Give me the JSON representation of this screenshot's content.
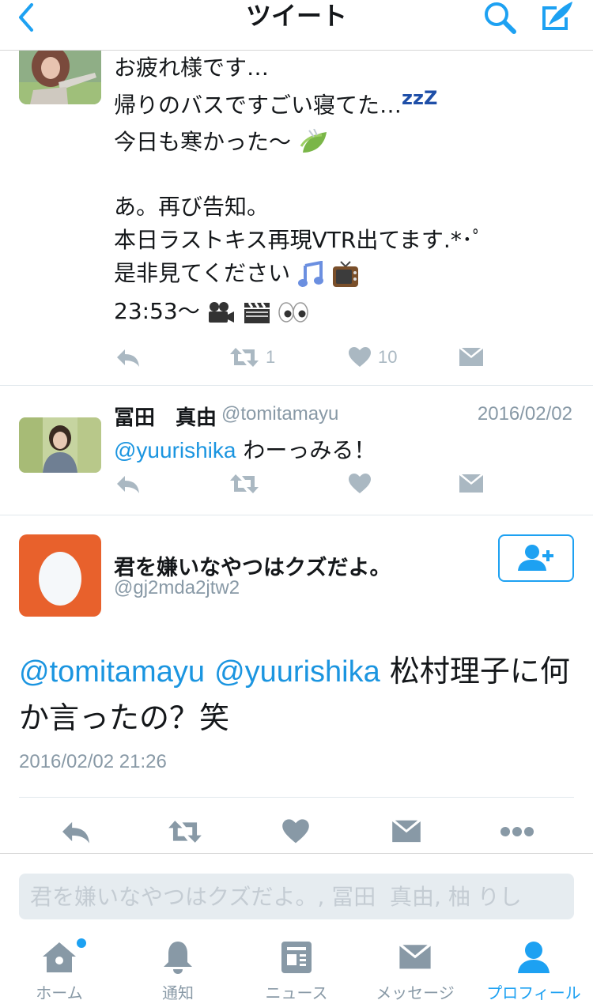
{
  "header": {
    "title": "ツイート"
  },
  "tweet1": {
    "lines": [
      "お疲れ様です…",
      "帰りのバスですごい寝てた…",
      "今日も寒かった〜",
      "あ。再び告知。",
      "本日ラストキス再現VTR出てます.*･ﾟ",
      "是非見てください",
      "23:53〜"
    ],
    "zzz": "zzZ",
    "retweet_count": "1",
    "like_count": "10"
  },
  "tweet2": {
    "name": "冨田　真由",
    "handle": "@tomitamayu",
    "date": "2016/02/02",
    "mention": "@yuurishika",
    "text": " わーっみる！"
  },
  "main": {
    "name": "君を嫌いなやつはクズだよ。",
    "handle": "@gj2mda2jtw2",
    "mention1": "@tomitamayu",
    "mention2": "@yuurishika",
    "text": " 松村理子に何か言ったの？笑",
    "timestamp": "2016/02/02 21:26"
  },
  "reply": {
    "placeholder": "君を嫌いなやつはクズだよ。, 冨田  真由, 柚 りし"
  },
  "tabs": [
    {
      "label": "ホーム"
    },
    {
      "label": "通知"
    },
    {
      "label": "ニュース"
    },
    {
      "label": "メッセージ"
    },
    {
      "label": "プロフィール"
    }
  ],
  "colors": {
    "accent": "#1da1f2",
    "muted": "#8899a6",
    "icon": "#aab8c2",
    "egg": "#e8612c"
  }
}
